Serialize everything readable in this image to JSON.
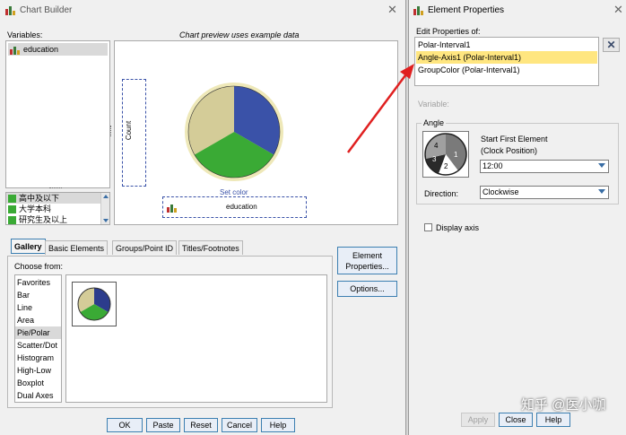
{
  "chart_builder": {
    "title": "Chart Builder",
    "variables_label": "Variables:",
    "preview_label": "Chart preview uses example data",
    "variables": [
      "education"
    ],
    "categories": [
      "高中及以下",
      "大学本科",
      "研究生及以上"
    ],
    "preview": {
      "count_label": "Count",
      "set_color_label": "Set color",
      "education_drop": "education"
    },
    "tabs": [
      "Gallery",
      "Basic Elements",
      "Groups/Point ID",
      "Titles/Footnotes"
    ],
    "choose_from_label": "Choose from:",
    "gallery_items": [
      "Favorites",
      "Bar",
      "Line",
      "Area",
      "Pie/Polar",
      "Scatter/Dot",
      "Histogram",
      "High-Low",
      "Boxplot",
      "Dual Axes"
    ],
    "selected_gallery_item": "Pie/Polar",
    "side_buttons": {
      "element_properties_1": "Element",
      "element_properties_2": "Properties...",
      "options": "Options..."
    },
    "buttons": {
      "ok": "OK",
      "paste": "Paste",
      "reset": "Reset",
      "cancel": "Cancel",
      "help": "Help"
    }
  },
  "element_properties": {
    "title": "Element Properties",
    "edit_label": "Edit Properties of:",
    "items": [
      "Polar-Interval1",
      "Angle-Axis1 (Polar-Interval1)",
      "GroupColor (Polar-Interval1)"
    ],
    "selected_item": "Angle-Axis1 (Polar-Interval1)",
    "variable_label": "Variable:",
    "angle_group_label": "Angle",
    "start_label_1": "Start First Element",
    "start_label_2": "(Clock Position)",
    "start_value": "12:00",
    "direction_label": "Direction:",
    "direction_value": "Clockwise",
    "slice_numbers": [
      "1",
      "2",
      "3",
      "4"
    ],
    "display_axis_label": "Display axis",
    "display_axis_checked": false,
    "buttons": {
      "apply": "Apply",
      "close": "Close",
      "help": "Help"
    }
  },
  "watermark": "知乎 @医小咖",
  "colors": {
    "pie_blue": "#3a52a8",
    "pie_green": "#3aaa35",
    "pie_tan": "#d4cc98",
    "selection_yellow": "#ffe680",
    "annotation_red": "#e02020",
    "button_border": "#3c7fb1"
  }
}
